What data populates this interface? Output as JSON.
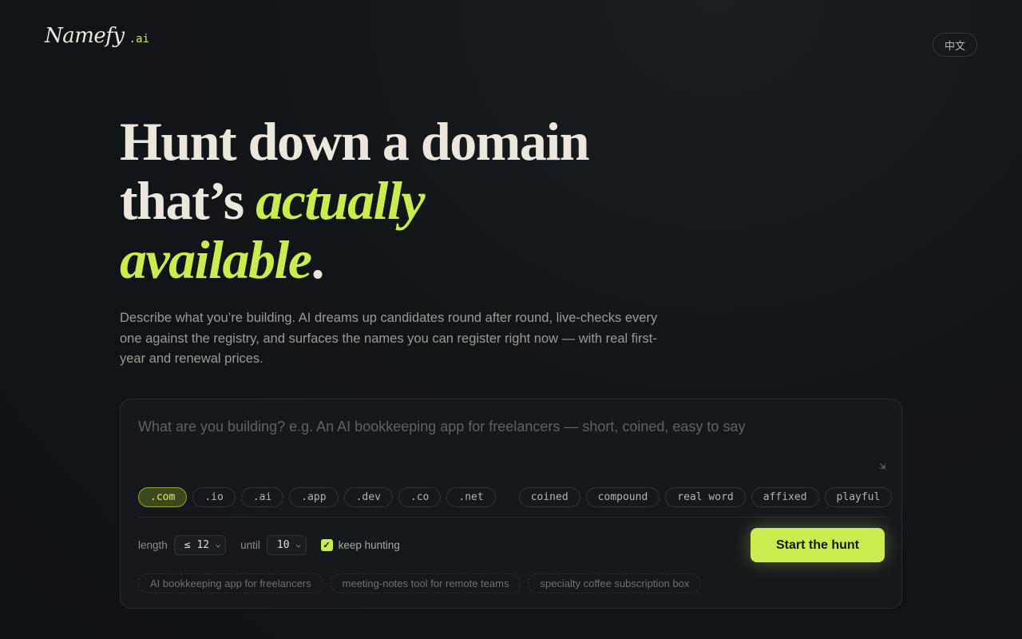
{
  "brand": {
    "name": "Namefy",
    "tld": ".ai"
  },
  "language_toggle": "中文",
  "hero": {
    "line1": "Hunt down a domain",
    "line2_plain": "that’s ",
    "line2_accent": "actually",
    "line3_accent": "available",
    "line3_end": "."
  },
  "subtitle": "Describe what you’re building. AI dreams up candidates round after round, live-checks every one against the registry, and surfaces the names you can register right now — with real first-year and renewal prices.",
  "prompt": {
    "value": "",
    "placeholder": "What are you building? e.g. An AI bookkeeping app for freelancers — short, coined, easy to say"
  },
  "tlds": [
    {
      "label": ".com",
      "selected": true
    },
    {
      "label": ".io",
      "selected": false
    },
    {
      "label": ".ai",
      "selected": false
    },
    {
      "label": ".app",
      "selected": false
    },
    {
      "label": ".dev",
      "selected": false
    },
    {
      "label": ".co",
      "selected": false
    },
    {
      "label": ".net",
      "selected": false
    }
  ],
  "styles": [
    "coined",
    "compound",
    "real word",
    "affixed",
    "playful"
  ],
  "controls": {
    "length_label": "length",
    "length_value": "≤ 12",
    "until_label": "until",
    "until_value": "10",
    "keep_hunting_label": "keep hunting",
    "keep_hunting_checked": true
  },
  "cta_label": "Start the hunt",
  "examples": [
    "AI bookkeeping app for freelancers",
    "meeting-notes tool for remote teams",
    "specialty coffee subscription box"
  ],
  "colors": {
    "accent": "#c9ec4f",
    "background": "#121518",
    "text": "#ece7dc"
  }
}
